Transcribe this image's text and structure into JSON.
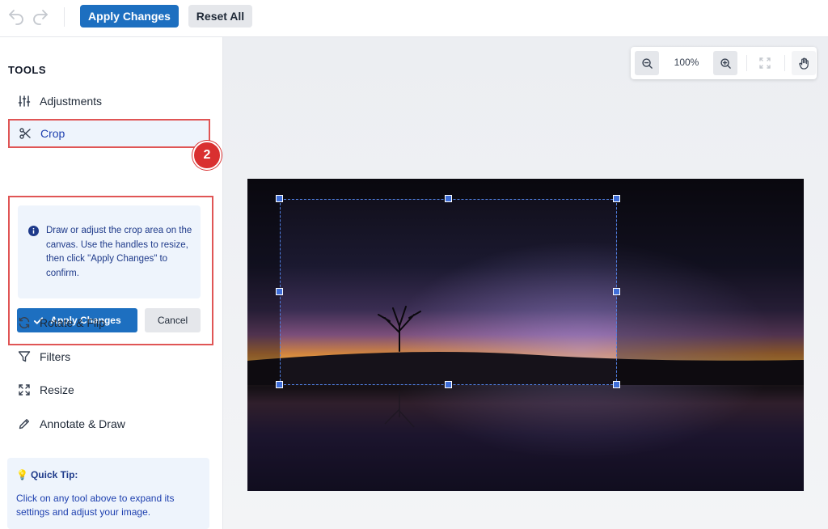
{
  "toolbar": {
    "apply_label": "Apply Changes",
    "reset_label": "Reset All"
  },
  "sidebar": {
    "title": "TOOLS",
    "tools": [
      {
        "label": "Adjustments",
        "icon": "sliders-icon"
      },
      {
        "label": "Crop",
        "icon": "scissors-icon",
        "active": true
      },
      {
        "label": "Rotate & Flip",
        "icon": "rotate-icon"
      },
      {
        "label": "Filters",
        "icon": "filter-icon"
      },
      {
        "label": "Resize",
        "icon": "expand-icon"
      },
      {
        "label": "Annotate & Draw",
        "icon": "pencil-icon"
      }
    ],
    "step_badge": "2",
    "crop_panel": {
      "info": "Draw or adjust the crop area on the canvas. Use the handles to resize, then click \"Apply Changes\" to confirm.",
      "apply_label": "Apply Changes",
      "cancel_label": "Cancel"
    },
    "tip": {
      "title": "Quick Tip:",
      "text": "Click on any tool above to expand its settings and adjust your image."
    }
  },
  "canvas": {
    "zoom_level": "100%"
  },
  "colors": {
    "primary": "#1d6fc0",
    "highlight": "#e05555",
    "info_bg": "#eef4fc"
  }
}
